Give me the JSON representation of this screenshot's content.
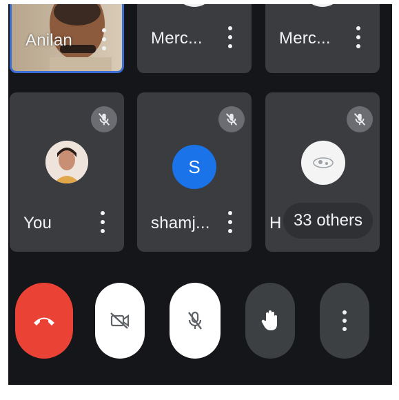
{
  "tiles": {
    "anilan": {
      "name": "Anilan"
    },
    "top_middle": {
      "name": "Merc..."
    },
    "top_right": {
      "name": "Merc..."
    },
    "you": {
      "name": "You"
    },
    "shamj": {
      "name": "shamj...",
      "initial": "S"
    },
    "others": {
      "partial_name": "H",
      "count_label": "33 others"
    }
  },
  "icons": {
    "muted": "mic-off-icon",
    "menu": "more-vert-icon",
    "end_call": "call-end-icon",
    "camera": "videocam-off-icon",
    "mic": "mic-off-icon",
    "raise_hand": "hand-icon",
    "more": "more-vert-icon"
  },
  "colors": {
    "background": "#15161a",
    "tile": "#3a3c40",
    "active_speaker_border": "#3b6fd6",
    "end_call": "#ea4335",
    "avatar_blue": "#1a73e8",
    "control_light": "#ffffff",
    "control_dark": "#3c4043"
  }
}
